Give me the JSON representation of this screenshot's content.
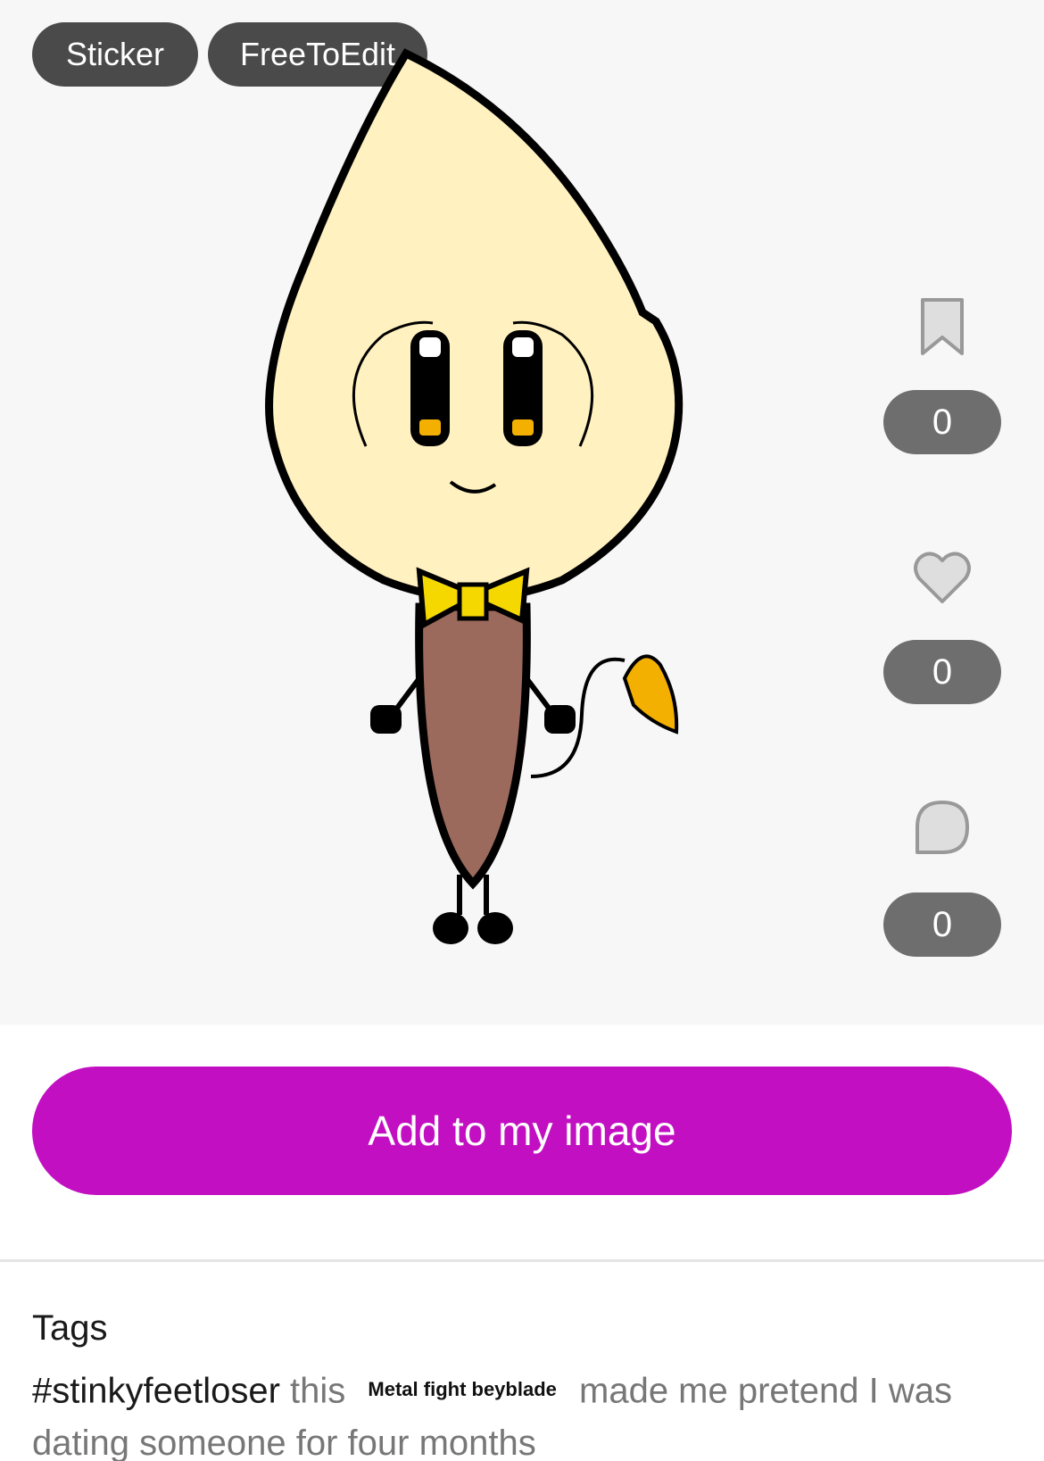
{
  "chips": {
    "sticker": "Sticker",
    "free_to_edit": "FreeToEdit"
  },
  "actions": {
    "save_count": "0",
    "like_count": "0",
    "comment_count": "0"
  },
  "add_button_label": "Add to my image",
  "tags": {
    "heading": "Tags",
    "hashtag": "#stinkyfeetloser",
    "text_before": " this ",
    "inline_label": "Metal fight beyblade",
    "text_after": " made me pretend I was dating someone for four months"
  },
  "colors": {
    "accent": "#c20fc2",
    "chip_bg": "#4a4a4a",
    "pill_bg": "#6e6e6e",
    "canvas_bg": "#f7f7f7"
  },
  "icons": [
    "bookmark-icon",
    "heart-icon",
    "comment-icon"
  ]
}
